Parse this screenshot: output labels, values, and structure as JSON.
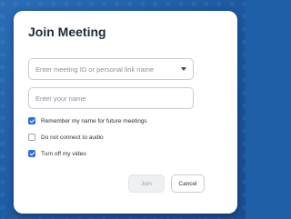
{
  "dialog": {
    "title": "Join Meeting",
    "meeting_id_field": {
      "placeholder": "Enter meeting ID or personal link name"
    },
    "name_field": {
      "placeholder": "Enter your name"
    },
    "options": [
      {
        "label": "Remember my name for future meetings",
        "checked": true
      },
      {
        "label": "Do not connect to audio",
        "checked": false
      },
      {
        "label": "Turn off my video",
        "checked": true
      }
    ],
    "buttons": {
      "join_label": "Join",
      "cancel_label": "Cancel"
    }
  },
  "colors": {
    "background": "#1e5fa8",
    "checkbox_accent": "#2d6fe0"
  },
  "icons": {
    "dropdown": "chevron-down-icon"
  }
}
